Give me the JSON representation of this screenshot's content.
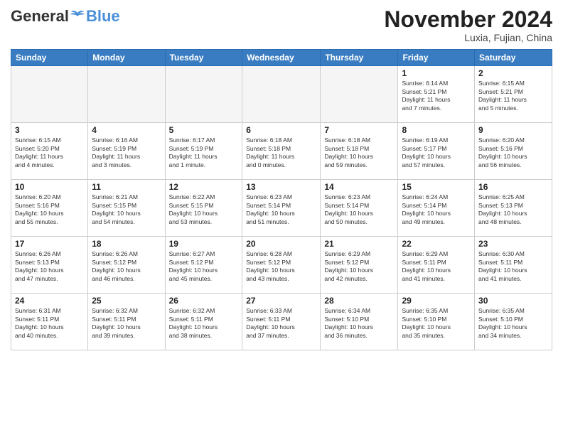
{
  "header": {
    "logo_general": "General",
    "logo_blue": "Blue",
    "month_title": "November 2024",
    "location": "Luxia, Fujian, China"
  },
  "weekdays": [
    "Sunday",
    "Monday",
    "Tuesday",
    "Wednesday",
    "Thursday",
    "Friday",
    "Saturday"
  ],
  "weeks": [
    [
      {
        "day": "",
        "info": ""
      },
      {
        "day": "",
        "info": ""
      },
      {
        "day": "",
        "info": ""
      },
      {
        "day": "",
        "info": ""
      },
      {
        "day": "",
        "info": ""
      },
      {
        "day": "1",
        "info": "Sunrise: 6:14 AM\nSunset: 5:21 PM\nDaylight: 11 hours\nand 7 minutes."
      },
      {
        "day": "2",
        "info": "Sunrise: 6:15 AM\nSunset: 5:21 PM\nDaylight: 11 hours\nand 5 minutes."
      }
    ],
    [
      {
        "day": "3",
        "info": "Sunrise: 6:15 AM\nSunset: 5:20 PM\nDaylight: 11 hours\nand 4 minutes."
      },
      {
        "day": "4",
        "info": "Sunrise: 6:16 AM\nSunset: 5:19 PM\nDaylight: 11 hours\nand 3 minutes."
      },
      {
        "day": "5",
        "info": "Sunrise: 6:17 AM\nSunset: 5:19 PM\nDaylight: 11 hours\nand 1 minute."
      },
      {
        "day": "6",
        "info": "Sunrise: 6:18 AM\nSunset: 5:18 PM\nDaylight: 11 hours\nand 0 minutes."
      },
      {
        "day": "7",
        "info": "Sunrise: 6:18 AM\nSunset: 5:18 PM\nDaylight: 10 hours\nand 59 minutes."
      },
      {
        "day": "8",
        "info": "Sunrise: 6:19 AM\nSunset: 5:17 PM\nDaylight: 10 hours\nand 57 minutes."
      },
      {
        "day": "9",
        "info": "Sunrise: 6:20 AM\nSunset: 5:16 PM\nDaylight: 10 hours\nand 56 minutes."
      }
    ],
    [
      {
        "day": "10",
        "info": "Sunrise: 6:20 AM\nSunset: 5:16 PM\nDaylight: 10 hours\nand 55 minutes."
      },
      {
        "day": "11",
        "info": "Sunrise: 6:21 AM\nSunset: 5:15 PM\nDaylight: 10 hours\nand 54 minutes."
      },
      {
        "day": "12",
        "info": "Sunrise: 6:22 AM\nSunset: 5:15 PM\nDaylight: 10 hours\nand 53 minutes."
      },
      {
        "day": "13",
        "info": "Sunrise: 6:23 AM\nSunset: 5:14 PM\nDaylight: 10 hours\nand 51 minutes."
      },
      {
        "day": "14",
        "info": "Sunrise: 6:23 AM\nSunset: 5:14 PM\nDaylight: 10 hours\nand 50 minutes."
      },
      {
        "day": "15",
        "info": "Sunrise: 6:24 AM\nSunset: 5:14 PM\nDaylight: 10 hours\nand 49 minutes."
      },
      {
        "day": "16",
        "info": "Sunrise: 6:25 AM\nSunset: 5:13 PM\nDaylight: 10 hours\nand 48 minutes."
      }
    ],
    [
      {
        "day": "17",
        "info": "Sunrise: 6:26 AM\nSunset: 5:13 PM\nDaylight: 10 hours\nand 47 minutes."
      },
      {
        "day": "18",
        "info": "Sunrise: 6:26 AM\nSunset: 5:12 PM\nDaylight: 10 hours\nand 46 minutes."
      },
      {
        "day": "19",
        "info": "Sunrise: 6:27 AM\nSunset: 5:12 PM\nDaylight: 10 hours\nand 45 minutes."
      },
      {
        "day": "20",
        "info": "Sunrise: 6:28 AM\nSunset: 5:12 PM\nDaylight: 10 hours\nand 43 minutes."
      },
      {
        "day": "21",
        "info": "Sunrise: 6:29 AM\nSunset: 5:12 PM\nDaylight: 10 hours\nand 42 minutes."
      },
      {
        "day": "22",
        "info": "Sunrise: 6:29 AM\nSunset: 5:11 PM\nDaylight: 10 hours\nand 41 minutes."
      },
      {
        "day": "23",
        "info": "Sunrise: 6:30 AM\nSunset: 5:11 PM\nDaylight: 10 hours\nand 41 minutes."
      }
    ],
    [
      {
        "day": "24",
        "info": "Sunrise: 6:31 AM\nSunset: 5:11 PM\nDaylight: 10 hours\nand 40 minutes."
      },
      {
        "day": "25",
        "info": "Sunrise: 6:32 AM\nSunset: 5:11 PM\nDaylight: 10 hours\nand 39 minutes."
      },
      {
        "day": "26",
        "info": "Sunrise: 6:32 AM\nSunset: 5:11 PM\nDaylight: 10 hours\nand 38 minutes."
      },
      {
        "day": "27",
        "info": "Sunrise: 6:33 AM\nSunset: 5:11 PM\nDaylight: 10 hours\nand 37 minutes."
      },
      {
        "day": "28",
        "info": "Sunrise: 6:34 AM\nSunset: 5:10 PM\nDaylight: 10 hours\nand 36 minutes."
      },
      {
        "day": "29",
        "info": "Sunrise: 6:35 AM\nSunset: 5:10 PM\nDaylight: 10 hours\nand 35 minutes."
      },
      {
        "day": "30",
        "info": "Sunrise: 6:35 AM\nSunset: 5:10 PM\nDaylight: 10 hours\nand 34 minutes."
      }
    ]
  ]
}
